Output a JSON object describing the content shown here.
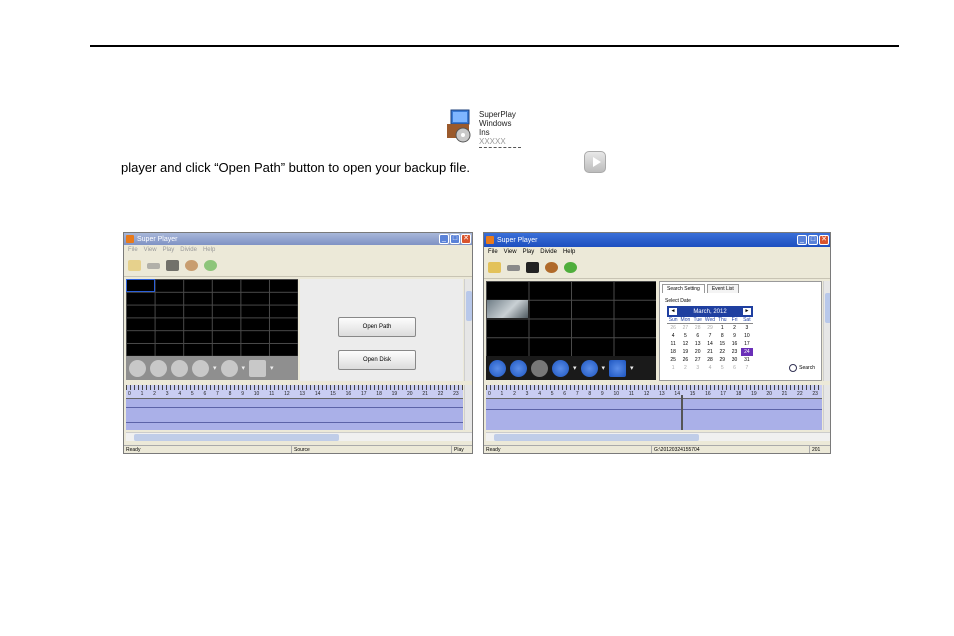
{
  "document": {
    "paragraph_end": "player and click “Open Path” button to open your backup file."
  },
  "installer_icon": {
    "label_line1": "SuperPlay",
    "label_line2": "Windows Ins",
    "label_line3": "XXXXX"
  },
  "window_left": {
    "title": "Super Player",
    "menu": [
      "File",
      "View",
      "Play",
      "Divide",
      "Help"
    ],
    "buttons": {
      "open_path": "Open Path",
      "open_disk": "Open Disk"
    },
    "ruler": [
      "0",
      "1",
      "2",
      "3",
      "4",
      "5",
      "6",
      "7",
      "8",
      "9",
      "10",
      "11",
      "12",
      "13",
      "14",
      "15",
      "16",
      "17",
      "18",
      "19",
      "20",
      "21",
      "22",
      "23"
    ],
    "status": {
      "state": "Ready",
      "source": "Source",
      "play": "Play"
    }
  },
  "window_right": {
    "title": "Super Player",
    "menu": [
      "File",
      "View",
      "Play",
      "Divide",
      "Help"
    ],
    "tabs": {
      "search_setting": "Search Setting",
      "event_list": "Event List"
    },
    "select_date_label": "Select Date",
    "calendar": {
      "month": "March, 2012",
      "prev": "◄",
      "next": "►",
      "dow": [
        "Sun",
        "Mon",
        "Tue",
        "Wed",
        "Thu",
        "Fri",
        "Sat"
      ],
      "days": [
        "26",
        "27",
        "28",
        "29",
        "1",
        "2",
        "3",
        "4",
        "5",
        "6",
        "7",
        "8",
        "9",
        "10",
        "11",
        "12",
        "13",
        "14",
        "15",
        "16",
        "17",
        "18",
        "19",
        "20",
        "21",
        "22",
        "23",
        "24",
        "25",
        "26",
        "27",
        "28",
        "29",
        "30",
        "31",
        "1",
        "2",
        "3",
        "4",
        "5",
        "6",
        "7"
      ]
    },
    "search_label": "Search",
    "ruler": [
      "0",
      "1",
      "2",
      "3",
      "4",
      "5",
      "6",
      "7",
      "8",
      "9",
      "10",
      "11",
      "12",
      "13",
      "14",
      "15",
      "16",
      "17",
      "18",
      "19",
      "20",
      "21",
      "22",
      "23"
    ],
    "status": {
      "state": "Ready",
      "path": "G:\\20120324155704",
      "year": "201"
    }
  }
}
